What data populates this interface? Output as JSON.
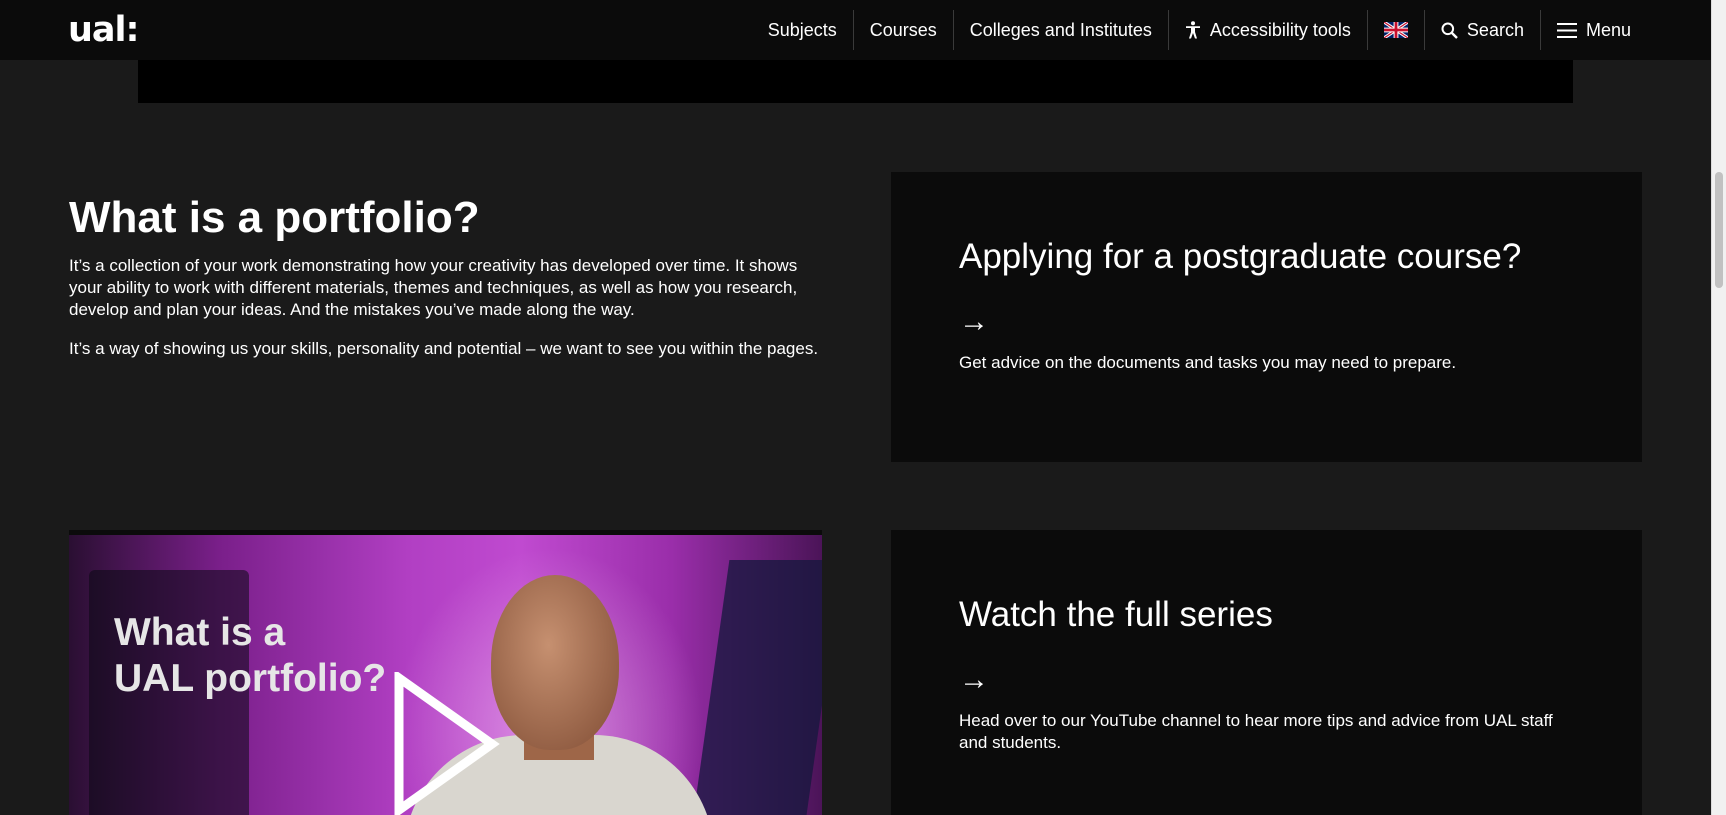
{
  "header": {
    "logo": "ual:",
    "nav": [
      {
        "label": "Subjects"
      },
      {
        "label": "Courses"
      },
      {
        "label": "Colleges and Institutes"
      },
      {
        "label": "Accessibility tools",
        "icon": "accessibility-icon"
      },
      {
        "label": "",
        "icon": "uk-flag-icon"
      },
      {
        "label": "Search",
        "icon": "search-icon"
      },
      {
        "label": "Menu",
        "icon": "hamburger-menu-icon"
      }
    ]
  },
  "intro": {
    "title": "What is a portfolio?",
    "paragraph1": "It’s a collection of your work demonstrating how your creativity has developed over time. It shows your ability to work with different materials, themes and techniques, as well as how you research, develop and plan your ideas. And the mistakes you’ve made along the way.",
    "paragraph2": "It’s a way of showing us your skills, personality and potential – we want to see you within the pages."
  },
  "cards": [
    {
      "title": "Applying for a postgraduate course?",
      "arrow": "→",
      "description": "Get advice on the documents and tasks you may need to prepare."
    },
    {
      "title": "Watch the full series",
      "arrow": "→",
      "description": "Head over to our YouTube channel to hear more tips and advice from UAL staff and students."
    }
  ],
  "video": {
    "thumbnail_text_line1": "What is a",
    "thumbnail_text_line2": "UAL portfolio?",
    "play_icon": "play-icon"
  },
  "colors": {
    "page_background": "#1a1a1a",
    "header_background": "#0b0b0b",
    "card_background": "#0b0b0b",
    "text": "#ffffff"
  }
}
